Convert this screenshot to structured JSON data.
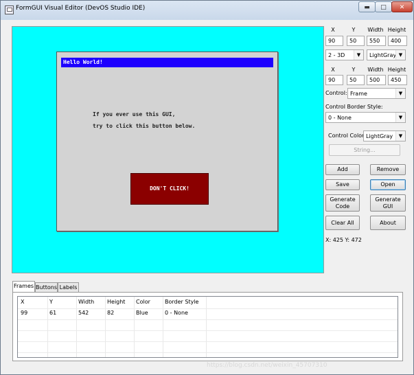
{
  "window": {
    "title": "FormGUI Visual Editor (DevOS Studio IDE)",
    "min_icon": "minimize-icon",
    "max_icon": "maximize-icon",
    "close_icon": "close-icon"
  },
  "preview": {
    "background_color": "#00ffff",
    "frame_title": "Hello World!",
    "line1": "If you ever use this GUI,",
    "line2": "try to click this button below.",
    "button_label": "DON'T CLICK!",
    "button_color": "#8b0000",
    "title_bar_color": "#1e00ff"
  },
  "props": {
    "headers1": {
      "x": "X",
      "y": "Y",
      "width": "Width",
      "height": "Height"
    },
    "row1": {
      "x": "90",
      "y": "50",
      "width": "550",
      "height": "400"
    },
    "border_combo": "2 - 3D",
    "color_combo": "LightGray",
    "headers2": {
      "x": "X",
      "y": "Y",
      "width": "Width",
      "height": "Height"
    },
    "row2": {
      "x": "90",
      "y": "50",
      "width": "500",
      "height": "450"
    },
    "control_label": "Control:",
    "control_value": "Frame",
    "border_style_label": "Control Border Style:",
    "border_style_value": "0 - None",
    "control_color_label": "Control Color:",
    "control_color_value": "LightGray",
    "string_button": "String..."
  },
  "buttons": {
    "add": "Add",
    "remove": "Remove",
    "save": "Save",
    "open": "Open",
    "generate_code_1": "Generate",
    "generate_code_2": "Code",
    "generate_gui_1": "Generate",
    "generate_gui_2": "GUI",
    "clear_all": "Clear All",
    "about": "About"
  },
  "coords": "X: 425  Y: 472",
  "tabs": [
    "Frames",
    "Buttons",
    "Labels"
  ],
  "table": {
    "headers": [
      "X",
      "Y",
      "Width",
      "Height",
      "Color",
      "Border Style"
    ],
    "rows": [
      [
        "99",
        "61",
        "542",
        "82",
        "Blue",
        "0 - None"
      ]
    ]
  },
  "watermark": "https://blog.csdn.net/weixin_45707310"
}
